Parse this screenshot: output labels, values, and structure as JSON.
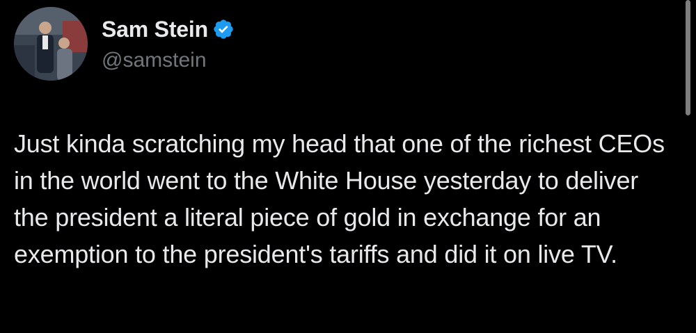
{
  "author": {
    "display_name": "Sam Stein",
    "handle": "@samstein",
    "verified": true,
    "avatar_icon": "profile-photo",
    "verified_icon": "verified-badge-icon"
  },
  "tweet": {
    "text": "Just kinda scratching my head that one of the richest CEOs in the world went to the White House yesterday to deliver the president a literal piece of gold in exchange for an exemption to the president's tariffs and did it on live TV."
  },
  "colors": {
    "background": "#000000",
    "text_primary": "#e7e9ea",
    "text_secondary": "#71767b",
    "verified_blue": "#1d9bf0"
  }
}
